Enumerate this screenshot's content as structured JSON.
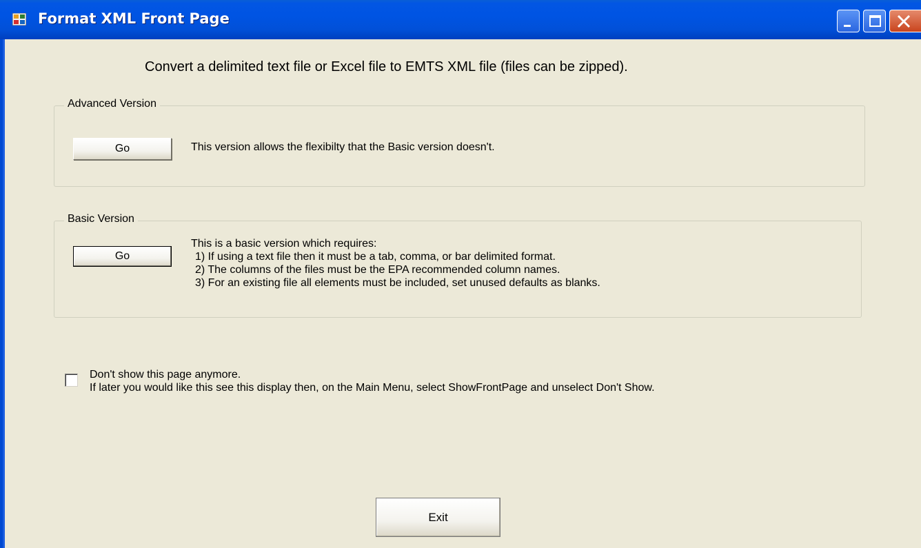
{
  "window": {
    "title": "Format XML Front Page",
    "icon": "app-window-icon",
    "controls": [
      "minimize-icon",
      "maximize-icon",
      "close-icon"
    ]
  },
  "header": {
    "text": "Convert a delimited text file or Excel file to EMTS XML file (files can be zipped)."
  },
  "advanced": {
    "legend": "Advanced Version",
    "button": "Go",
    "description": "This version allows the flexibilty that the Basic version doesn't."
  },
  "basic": {
    "legend": "Basic Version",
    "button": "Go",
    "lines": [
      "This is a basic version which requires:",
      "1) If using a text file then it must be a tab, comma, or bar delimited format.",
      "2) The columns of the files must be the EPA recommended column names.",
      "3) For an existing file all elements must be included, set unused defaults as blanks."
    ]
  },
  "dont_show": {
    "checked": false,
    "label": "Don't show this page anymore.",
    "note": "If later you would like this see this display then, on the Main Menu, select ShowFrontPage and unselect Don't Show."
  },
  "exit_button": "Exit",
  "colors": {
    "titlebar": "#0054e3",
    "background": "#ece9d8",
    "close_button": "#c9441d"
  }
}
